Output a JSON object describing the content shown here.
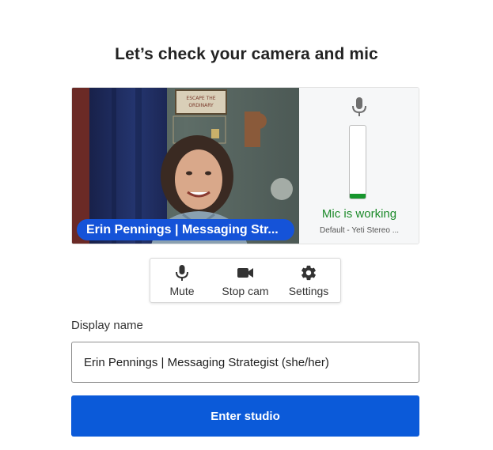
{
  "header": {
    "title": "Let’s check your camera and mic"
  },
  "preview": {
    "participant_name": "Erin Pennings | Messaging Str...",
    "poster_text": "ESCAPE THE ORDINARY",
    "mic_status": "Mic is working",
    "mic_device": "Default - Yeti Stereo ...",
    "mic_level": 0.07
  },
  "controls": {
    "mute_label": "Mute",
    "stop_cam_label": "Stop cam",
    "settings_label": "Settings"
  },
  "display_name": {
    "label": "Display name",
    "value": "Erin Pennings | Messaging Strategist (she/her)"
  },
  "enter_button": {
    "label": "Enter studio"
  },
  "colors": {
    "accent": "#0b5ad9",
    "name_chip": "#1553d8",
    "mic_ok": "#1c8a2a",
    "meter_fill": "#17962d"
  },
  "icons": [
    "microphone-icon",
    "camera-icon",
    "gear-icon"
  ]
}
